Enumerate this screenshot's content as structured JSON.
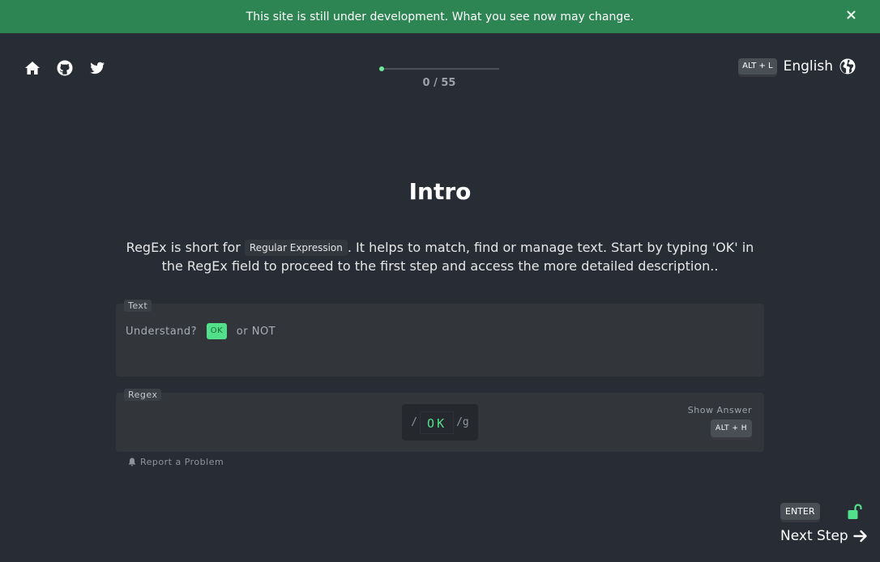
{
  "banner": {
    "message": "This site is still under development. What you see now may change.",
    "close_icon": "×"
  },
  "header": {
    "icons": [
      "home-icon",
      "github-icon",
      "twitter-icon"
    ],
    "progress": {
      "current": 0,
      "total": 55,
      "label": "0 / 55"
    },
    "language": {
      "shortcut": "ALT + L",
      "label": "English",
      "icon": "globe-icon"
    }
  },
  "lesson": {
    "title": "Intro",
    "description_before": "RegEx is short for ",
    "description_code": "Regular Expression",
    "description_after": ". It helps to match, find or manage text. Start by typing 'OK' in the RegEx field to proceed to the first step and access the more detailed description.."
  },
  "text_panel": {
    "tag": "Text",
    "before": "Understand? ",
    "match": "OK",
    "after": " or NOT"
  },
  "regex_panel": {
    "tag": "Regex",
    "open_slash": "/",
    "value": "OK",
    "flags": "/g",
    "show_answer_label": "Show Answer",
    "show_answer_shortcut": "ALT + H"
  },
  "report": {
    "label": "Report a Problem",
    "icon": "bell-icon"
  },
  "footer": {
    "enter_shortcut": "ENTER",
    "next_step_label": "Next Step",
    "lock_icon": "unlock-icon",
    "arrow_icon": "arrow-right-icon"
  },
  "colors": {
    "banner": "#2e8554",
    "background": "#282c34",
    "accent": "#52e08b",
    "panel": "#32353a"
  }
}
